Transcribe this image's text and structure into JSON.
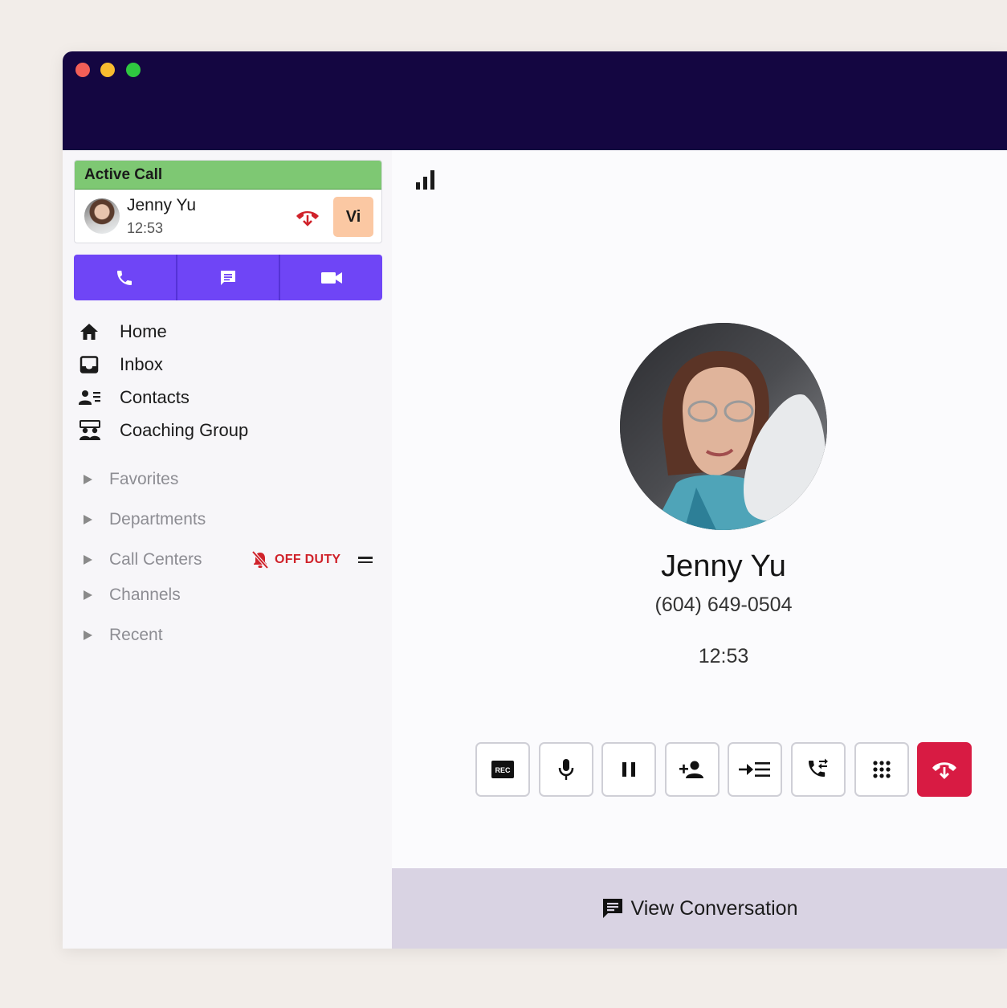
{
  "window": {
    "traffic_lights": {
      "close": "#f25f57",
      "minimize": "#f9bc2f",
      "zoom": "#2fc840"
    },
    "titlebar_color": "#140641"
  },
  "active_call": {
    "header": "Active Call",
    "caller_name": "Jenny Yu",
    "duration": "12:53",
    "badge": "Vi",
    "badge_color": "#fbc8a3",
    "header_color": "#7ec873"
  },
  "mode_bar": {
    "accent": "#6f45f6",
    "buttons": [
      {
        "icon": "phone-icon"
      },
      {
        "icon": "message-icon"
      },
      {
        "icon": "video-icon"
      }
    ]
  },
  "nav": {
    "items": [
      {
        "label": "Home",
        "icon": "home-icon"
      },
      {
        "label": "Inbox",
        "icon": "inbox-icon"
      },
      {
        "label": "Contacts",
        "icon": "contacts-icon"
      },
      {
        "label": "Coaching Group",
        "icon": "coaching-group-icon"
      }
    ]
  },
  "groups": {
    "items": [
      {
        "label": "Favorites"
      },
      {
        "label": "Departments"
      },
      {
        "label": "Call Centers",
        "status": "OFF DUTY",
        "status_color": "#d0222a"
      },
      {
        "label": "Channels"
      },
      {
        "label": "Recent"
      }
    ]
  },
  "call_view": {
    "name": "Jenny Yu",
    "phone": "(604) 649-0504",
    "timer": "12:53",
    "signal_icon": "signal-bars-icon",
    "controls": [
      {
        "icon": "record-icon",
        "text": "REC"
      },
      {
        "icon": "microphone-icon"
      },
      {
        "icon": "pause-icon"
      },
      {
        "icon": "add-person-icon"
      },
      {
        "icon": "transfer-icon"
      },
      {
        "icon": "call-forward-icon"
      },
      {
        "icon": "keypad-icon"
      },
      {
        "icon": "hang-up-icon"
      }
    ],
    "hangup_color": "#d81b43"
  },
  "conversation": {
    "label": "View Conversation",
    "icon": "chat-bubble-icon",
    "bar_color": "#d9d3e3"
  }
}
